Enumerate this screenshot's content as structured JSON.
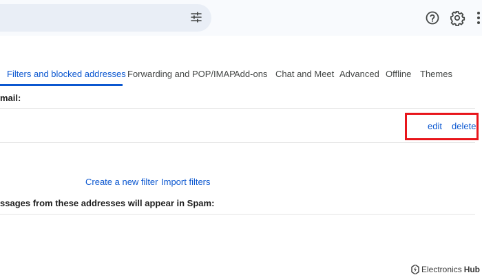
{
  "tabs": [
    {
      "label": "Filters and blocked addresses",
      "active": true
    },
    {
      "label": "Forwarding and POP/IMAP",
      "active": false
    },
    {
      "label": "Add-ons",
      "active": false
    },
    {
      "label": "Chat and Meet",
      "active": false
    },
    {
      "label": "Advanced",
      "active": false
    },
    {
      "label": "Offline",
      "active": false
    },
    {
      "label": "Themes",
      "active": false
    }
  ],
  "filters_section": {
    "heading": "mail:",
    "edit_label": "edit",
    "delete_label": "delete",
    "create_filter_label": "Create a new filter",
    "import_filters_label": "Import filters"
  },
  "blocked_section": {
    "heading": "ssages from these addresses will appear in Spam:"
  },
  "icons": {
    "search_options": "tune-icon",
    "help": "help-icon",
    "settings": "gear-icon",
    "apps": "apps-grid-icon"
  },
  "colors": {
    "accent": "#0b57d0",
    "highlight": "#e8151b",
    "header_bg": "#f8fafd",
    "search_bg": "#e9eef6"
  },
  "watermark": {
    "brand": "Electronics",
    "brand_bold": "Hub"
  }
}
